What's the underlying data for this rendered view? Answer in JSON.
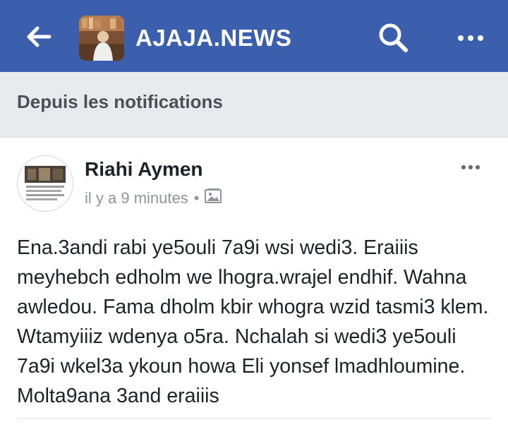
{
  "header": {
    "page_name": "AJAJA.NEWS",
    "back_icon": "back-arrow-icon",
    "search_icon": "search-icon",
    "more_icon": "more-options-icon",
    "bar_color": "#3b5fad"
  },
  "notice": {
    "text": "Depuis les notifications"
  },
  "post": {
    "author": "Riahi Aymen",
    "time": "il y a 9 minutes",
    "separator": "•",
    "audience_icon": "photo-album-icon",
    "more_icon": "more-options-icon",
    "body": "Ena.3andi rabi ye5ouli 7a9i wsi wedi3. Eraiiis meyhebch edholm we lhogra.wrajel endhif. Wahna awledou. Fama dholm kbir whogra wzid tasmi3 klem. Wtamyiiiz wdenya o5ra. Nchalah si wedi3 ye5ouli 7a9i wkel3a ykoun howa Eli yonsef lmadhloumine. Molta9ana 3and eraiiis"
  }
}
